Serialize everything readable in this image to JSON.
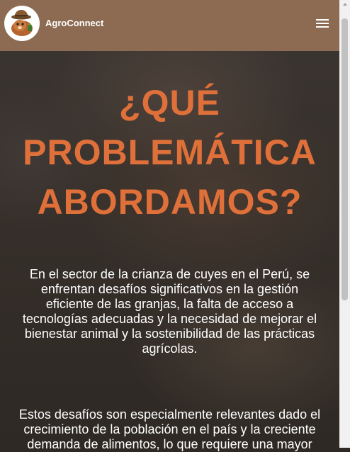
{
  "navbar": {
    "brand": "AgroConnect",
    "bg_color": "#8c6b52",
    "logo_icon": "guinea-pig-farmer-logo",
    "menu_icon": "hamburger-menu-icon"
  },
  "hero": {
    "title_lines": [
      "¿QUÉ",
      "PROBLEMÁTICA",
      "ABORDAMOS?"
    ],
    "title_color": "#e0703a",
    "paragraph1_lines": [
      "En el sector de la crianza de cuyes en el Perú, se",
      "enfrentan desafíos significativos en la gestión",
      "eficiente de las granjas, la falta de acceso a",
      "tecnologías adecuadas y la necesidad de mejorar el",
      "bienestar animal y la sostenibilidad de las prácticas",
      "agrícolas."
    ],
    "paragraph2_lines": [
      "Estos desafíos son especialmente relevantes dado el",
      "crecimiento de la población en el país y la creciente",
      "demanda de alimentos, lo que requiere una mayor"
    ]
  }
}
